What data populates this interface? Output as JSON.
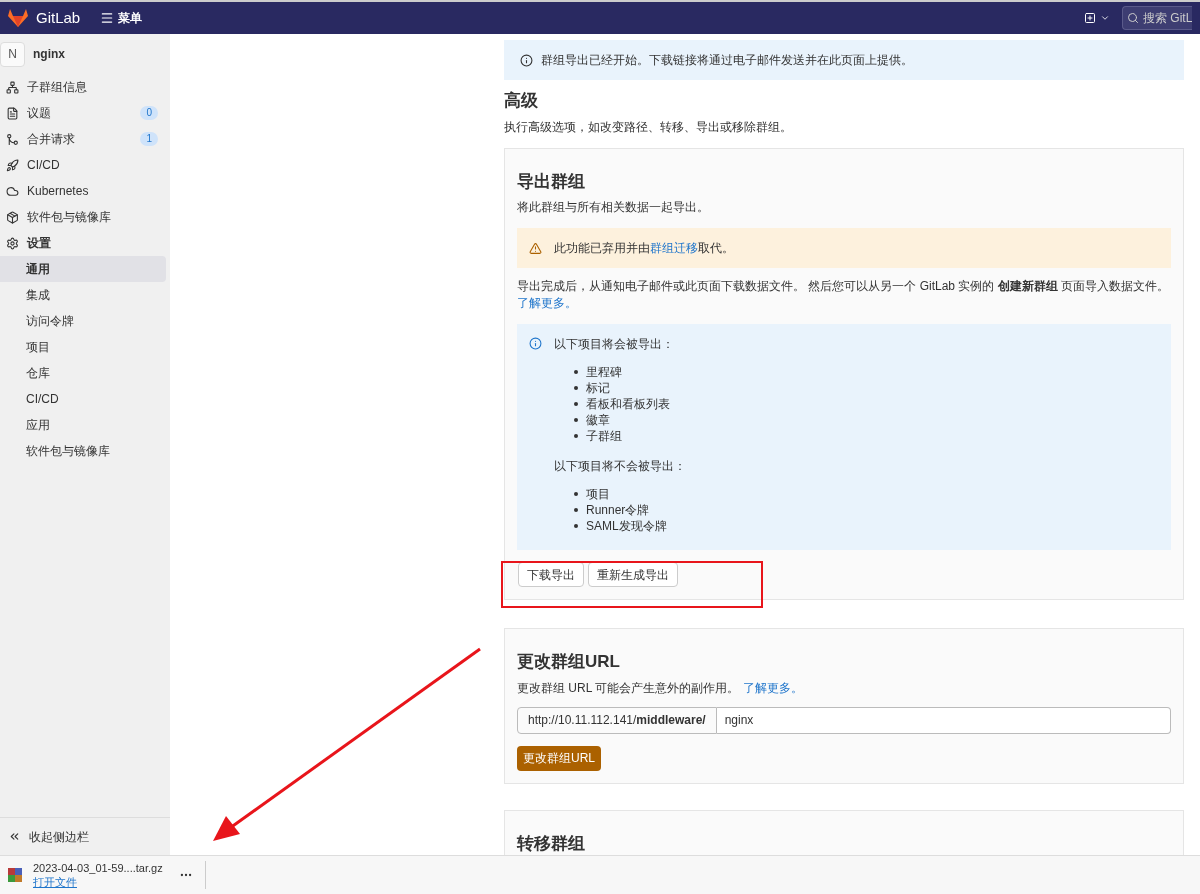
{
  "header": {
    "logo_text": "GitLab",
    "menu_label": "菜单",
    "search_placeholder": "搜索 GitL"
  },
  "sidebar": {
    "group": {
      "avatar": "N",
      "name": "nginx"
    },
    "items": [
      {
        "kind": "subgroups",
        "label": "子群组信息"
      },
      {
        "kind": "issues",
        "label": "议题",
        "badge": "0"
      },
      {
        "kind": "merge_requests",
        "label": "合并请求",
        "badge": "1"
      },
      {
        "kind": "cicd",
        "label": "CI/CD"
      },
      {
        "kind": "kubernetes",
        "label": "Kubernetes"
      },
      {
        "kind": "packages",
        "label": "软件包与镜像库"
      },
      {
        "kind": "settings",
        "label": "设置",
        "children": [
          {
            "label": "通用",
            "selected": true
          },
          {
            "label": "集成",
            "selected": false
          },
          {
            "label": "访问令牌",
            "selected": false
          },
          {
            "label": "项目",
            "selected": false
          },
          {
            "label": "仓库",
            "selected": false
          },
          {
            "label": "CI/CD",
            "selected": false
          },
          {
            "label": "应用",
            "selected": false
          },
          {
            "label": "软件包与镜像库",
            "selected": false
          }
        ]
      }
    ],
    "collapse_label": "收起侧边栏"
  },
  "main": {
    "alert": "群组导出已经开始。下载链接将通过电子邮件发送并在此页面上提供。",
    "title": "高级",
    "description": "执行高级选项，如改变路径、转移、导出或移除群组。",
    "export_card": {
      "title": "导出群组",
      "description": "将此群组与所有相关数据一起导出。",
      "warning": {
        "before": "此功能已弃用并由",
        "link": "群组迁移",
        "after": "取代。"
      },
      "note": "导出完成后，从通知电子邮件或此页面下载数据文件。 然后您可以从另一个 GitLab 实例的 **创建新群组** 页面导入数据文件。",
      "note_link": "了解更多。",
      "info": {
        "exported_heading": "以下项目将会被导出：",
        "exported": [
          "里程碑",
          "标记",
          "看板和看板列表",
          "徽章",
          "子群组"
        ],
        "not_exported_heading": "以下项目将不会被导出：",
        "not_exported": [
          "项目",
          "Runner令牌",
          "SAML发现令牌"
        ]
      },
      "buttons": [
        "下载导出",
        "重新生成导出"
      ]
    },
    "url_card": {
      "title": "更改群组URL",
      "description": "更改群组 URL 可能会产生意外的副作用。",
      "link": "了解更多。",
      "prefix": "http://10.11.112.141/**middleware/**",
      "value": "nginx",
      "button": "更改群组URL"
    },
    "transfer_card": {
      "title": "转移群组"
    }
  },
  "download_bar": {
    "file_name": "2023-04-03_01-59....tar.gz",
    "action": "打开文件"
  }
}
